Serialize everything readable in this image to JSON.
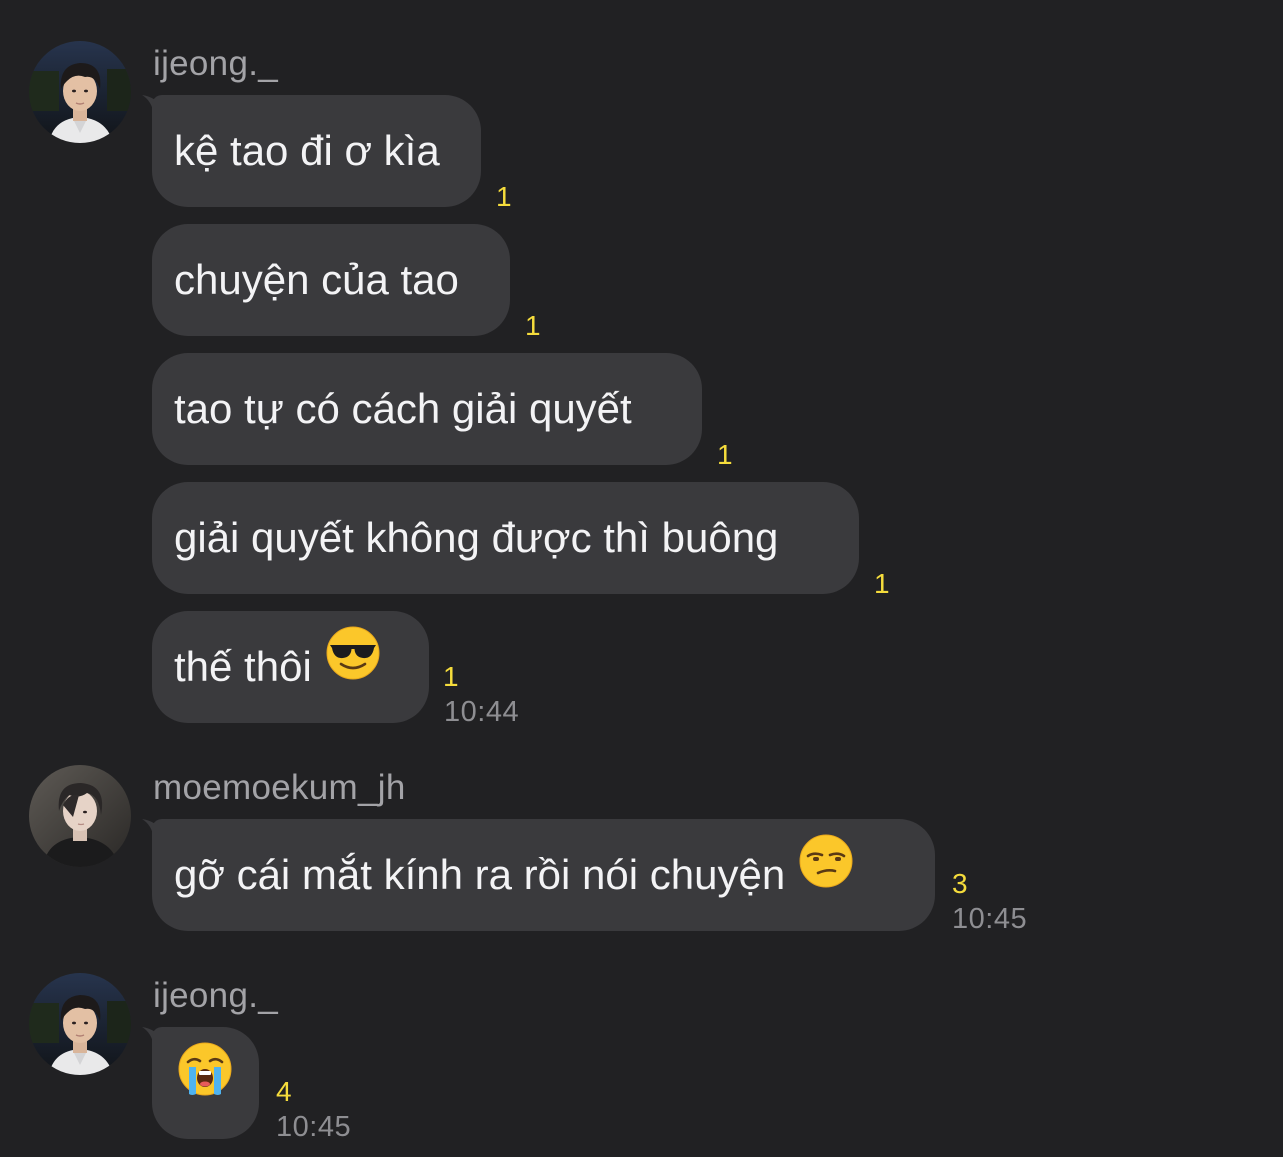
{
  "groups": [
    {
      "sender": "ijeong._",
      "avatar_icon": "profile-photo-ijeong",
      "messages": [
        {
          "text": "kệ tao đi ơ kìa",
          "unread": "1"
        },
        {
          "text": "chuyện của tao",
          "unread": "1"
        },
        {
          "text": "tao tự có cách giải quyết",
          "unread": "1"
        },
        {
          "text": "giải quyết không được thì buông",
          "unread": "1"
        },
        {
          "text": "thế thôi",
          "emoji": "smiling-face-with-sunglasses",
          "unread": "1",
          "time": "10:44"
        }
      ]
    },
    {
      "sender": "moemoekum_jh",
      "avatar_icon": "profile-photo-moemoekum",
      "messages": [
        {
          "text": "gỡ cái mắt kính ra rồi nói chuyện",
          "emoji": "unamused-face",
          "unread": "3",
          "time": "10:45"
        }
      ]
    },
    {
      "sender": "ijeong._",
      "avatar_icon": "profile-photo-ijeong",
      "messages": [
        {
          "text": "",
          "emoji": "loudly-crying-face",
          "unread": "4",
          "time": "10:45"
        }
      ]
    }
  ],
  "colors": {
    "background": "#212123",
    "bubble": "#3a3a3d",
    "unread_counter": "#f5dc3c",
    "timestamp": "#8e8e92",
    "username": "#a3a3a7"
  }
}
